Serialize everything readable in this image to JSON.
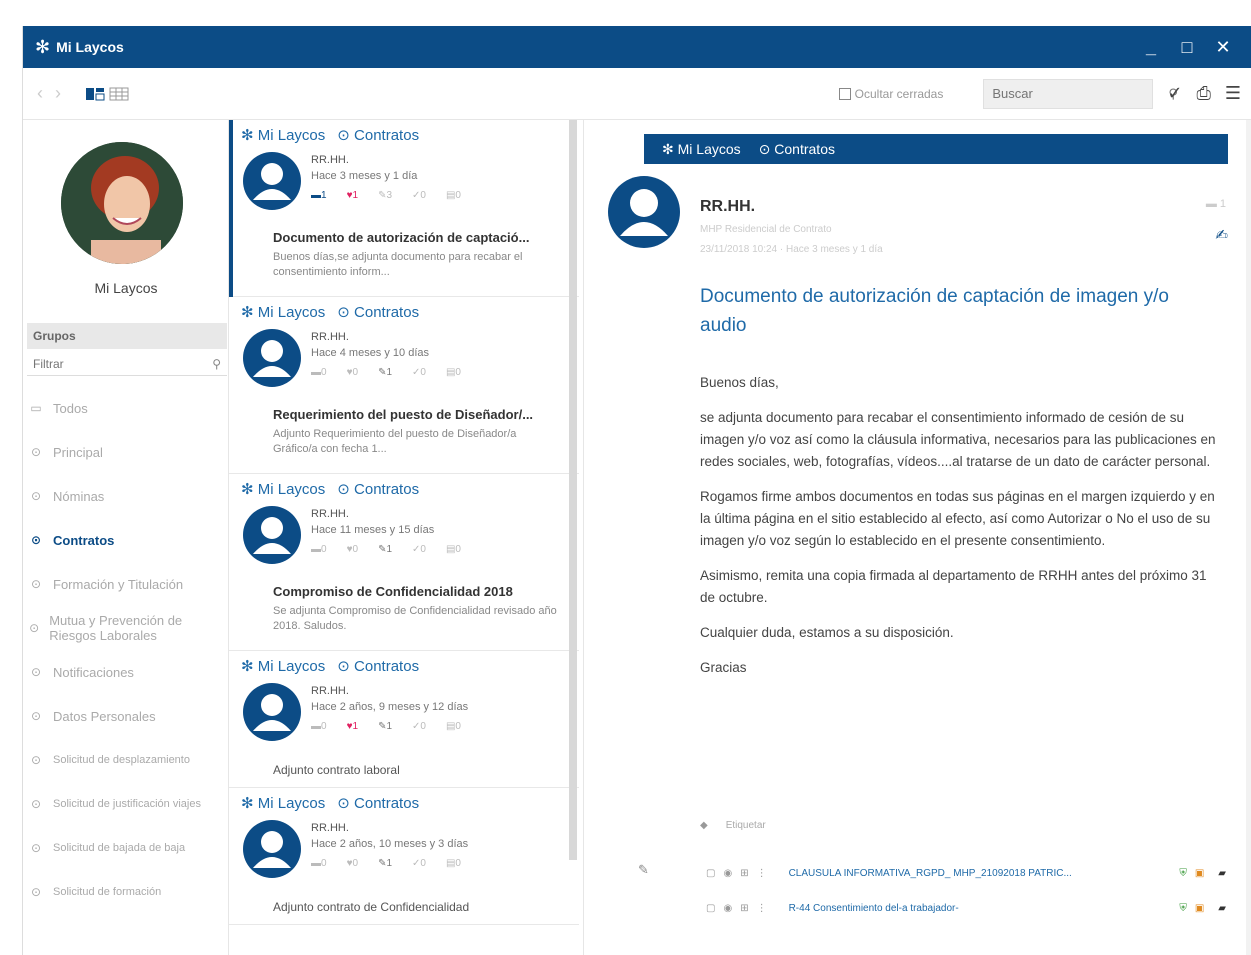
{
  "window": {
    "title": "Mi Laycos",
    "controls": [
      "_",
      "□",
      "✕"
    ]
  },
  "toolbar": {
    "hide_closed_label": "Ocultar cerradas",
    "search_placeholder": "Buscar"
  },
  "sidebar": {
    "user_name": "Mi Laycos",
    "groups_header": "Grupos",
    "filter_placeholder": "Filtrar",
    "items": [
      {
        "label": "Todos",
        "icon": "inbox-icon",
        "active": false
      },
      {
        "label": "Principal",
        "icon": "target-icon",
        "active": false
      },
      {
        "label": "Nóminas",
        "icon": "target-icon",
        "active": false
      },
      {
        "label": "Contratos",
        "icon": "target-icon",
        "active": true
      },
      {
        "label": "Formación y Titulación",
        "icon": "target-icon",
        "active": false
      },
      {
        "label": "Mutua y Prevención de Riesgos Laborales",
        "icon": "target-icon",
        "active": false
      },
      {
        "label": "Notificaciones",
        "icon": "target-icon",
        "active": false
      },
      {
        "label": "Datos Personales",
        "icon": "target-icon",
        "active": false
      },
      {
        "label": "Solicitud de desplazamiento",
        "icon": "target-icon",
        "active": false
      },
      {
        "label": "Solicitud de justificación viajes",
        "icon": "target-icon",
        "active": false
      },
      {
        "label": "Solicitud de bajada de baja",
        "icon": "target-icon",
        "active": false
      },
      {
        "label": "Solicitud de formación",
        "icon": "target-icon",
        "active": false
      }
    ]
  },
  "messages": [
    {
      "crumb_app": "Mi Laycos",
      "crumb_group": "Contratos",
      "sender": "RR.HH.",
      "time": "Hace 3 meses y 1 día",
      "stats": [
        "1",
        "1",
        "3",
        "0",
        "0"
      ],
      "subject": "Documento de autorización de captació...",
      "preview": "Buenos días,se adjunta documento para recabar el consentimiento inform..."
    },
    {
      "crumb_app": "Mi Laycos",
      "crumb_group": "Contratos",
      "sender": "RR.HH.",
      "time": "Hace 4 meses y 10 días",
      "stats": [
        "0",
        "0",
        "1",
        "0",
        "0"
      ],
      "subject": "Requerimiento del puesto de Diseñador/...",
      "preview": "Adjunto Requerimiento del puesto de Diseñador/a Gráfico/a con fecha 1..."
    },
    {
      "crumb_app": "Mi Laycos",
      "crumb_group": "Contratos",
      "sender": "RR.HH.",
      "time": "Hace 11 meses y 15 días",
      "stats": [
        "0",
        "0",
        "1",
        "0",
        "0"
      ],
      "subject": "Compromiso de Confidencialidad 2018",
      "preview": "Se adjunta Compromiso de Confidencialidad revisado año 2018. Saludos."
    },
    {
      "crumb_app": "Mi Laycos",
      "crumb_group": "Contratos",
      "sender": "RR.HH.",
      "time": "Hace 2 años, 9 meses y 12 días",
      "stats": [
        "0",
        "1",
        "1",
        "0",
        "0"
      ],
      "subject": "Adjunto contrato laboral",
      "preview": ""
    },
    {
      "crumb_app": "Mi Laycos",
      "crumb_group": "Contratos",
      "sender": "RR.HH.",
      "time": "Hace 2 años, 10 meses y 3 días",
      "stats": [
        "0",
        "0",
        "1",
        "0",
        "0"
      ],
      "subject": "Adjunto contrato de Confidencialidad",
      "preview": ""
    }
  ],
  "detail": {
    "crumb_app": "Mi Laycos",
    "crumb_group": "Contratos",
    "sender": "RR.HH.",
    "meta1": "MHP Residencial de Contrato",
    "meta2": "23/11/2018 10:24 · Hace 3 meses y 1 día",
    "comment_count": "1",
    "title": "Documento de autorización de captación de imagen y/o audio",
    "paragraphs": [
      "Buenos días,",
      "se adjunta documento para recabar el consentimiento informado de cesión de su imagen y/o voz así como la cláusula informativa, necesarios para las publicaciones en redes sociales, web, fotografías, vídeos....al tratarse de un dato de carácter personal.",
      "Rogamos firme ambos documentos en todas sus páginas en el margen izquierdo y en la última página en el sitio establecido al efecto, así como Autorizar o No el uso de su imagen y/o voz según lo establecido en el presente consentimiento.",
      "Asimismo, remita una copia firmada al departamento de RRHH antes del próximo 31 de octubre.",
      "Cualquier duda, estamos a su disposición.",
      "Gracias"
    ],
    "tags_label": "Etiquetar",
    "attachments": [
      {
        "name": "CLAUSULA INFORMATIVA_RGPD_ MHP_21092018 PATRIC..."
      },
      {
        "name": "R-44 Consentimiento del-a trabajador-"
      }
    ]
  },
  "colors": {
    "brand": "#0c4c86",
    "link": "#1f6aa8",
    "like": "#e02060"
  }
}
